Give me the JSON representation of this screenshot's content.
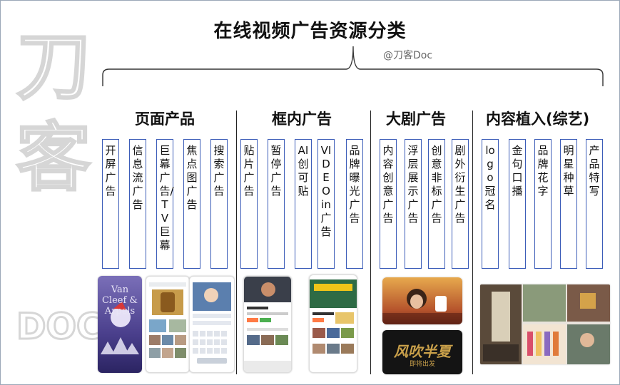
{
  "title": "在线视频广告资源分类",
  "credit": "@刀客Doc",
  "watermark": {
    "chars": [
      "刀",
      "客"
    ],
    "doc": "DOC"
  },
  "categories": [
    {
      "title": "页面产品",
      "items": [
        "开屏广告",
        "信息流广告",
        "巨幕广告/TV巨幕",
        "焦点图广告",
        "搜索广告"
      ]
    },
    {
      "title": "框内广告",
      "items": [
        "贴片广告",
        "暂停广告",
        "AI创可贴",
        "VIDEOin广告",
        "品牌曝光广告"
      ]
    },
    {
      "title": "大剧广告",
      "items": [
        "内容创意广告",
        "浮层展示广告",
        "创意非标广告",
        "剧外衍生广告"
      ]
    },
    {
      "title": "内容植入(综艺)",
      "items": [
        "logo冠名",
        "金句口播",
        "品牌花字",
        "明星种草",
        "产品特写"
      ]
    }
  ],
  "thumbnails": {
    "splash_brand": "Van Cleef & Arpels",
    "drama_title": "风吹半夏",
    "drama_subtitle": "即将出发"
  },
  "colors": {
    "box_border": "#3b5cb8",
    "watermark": "#d6d6d6"
  }
}
